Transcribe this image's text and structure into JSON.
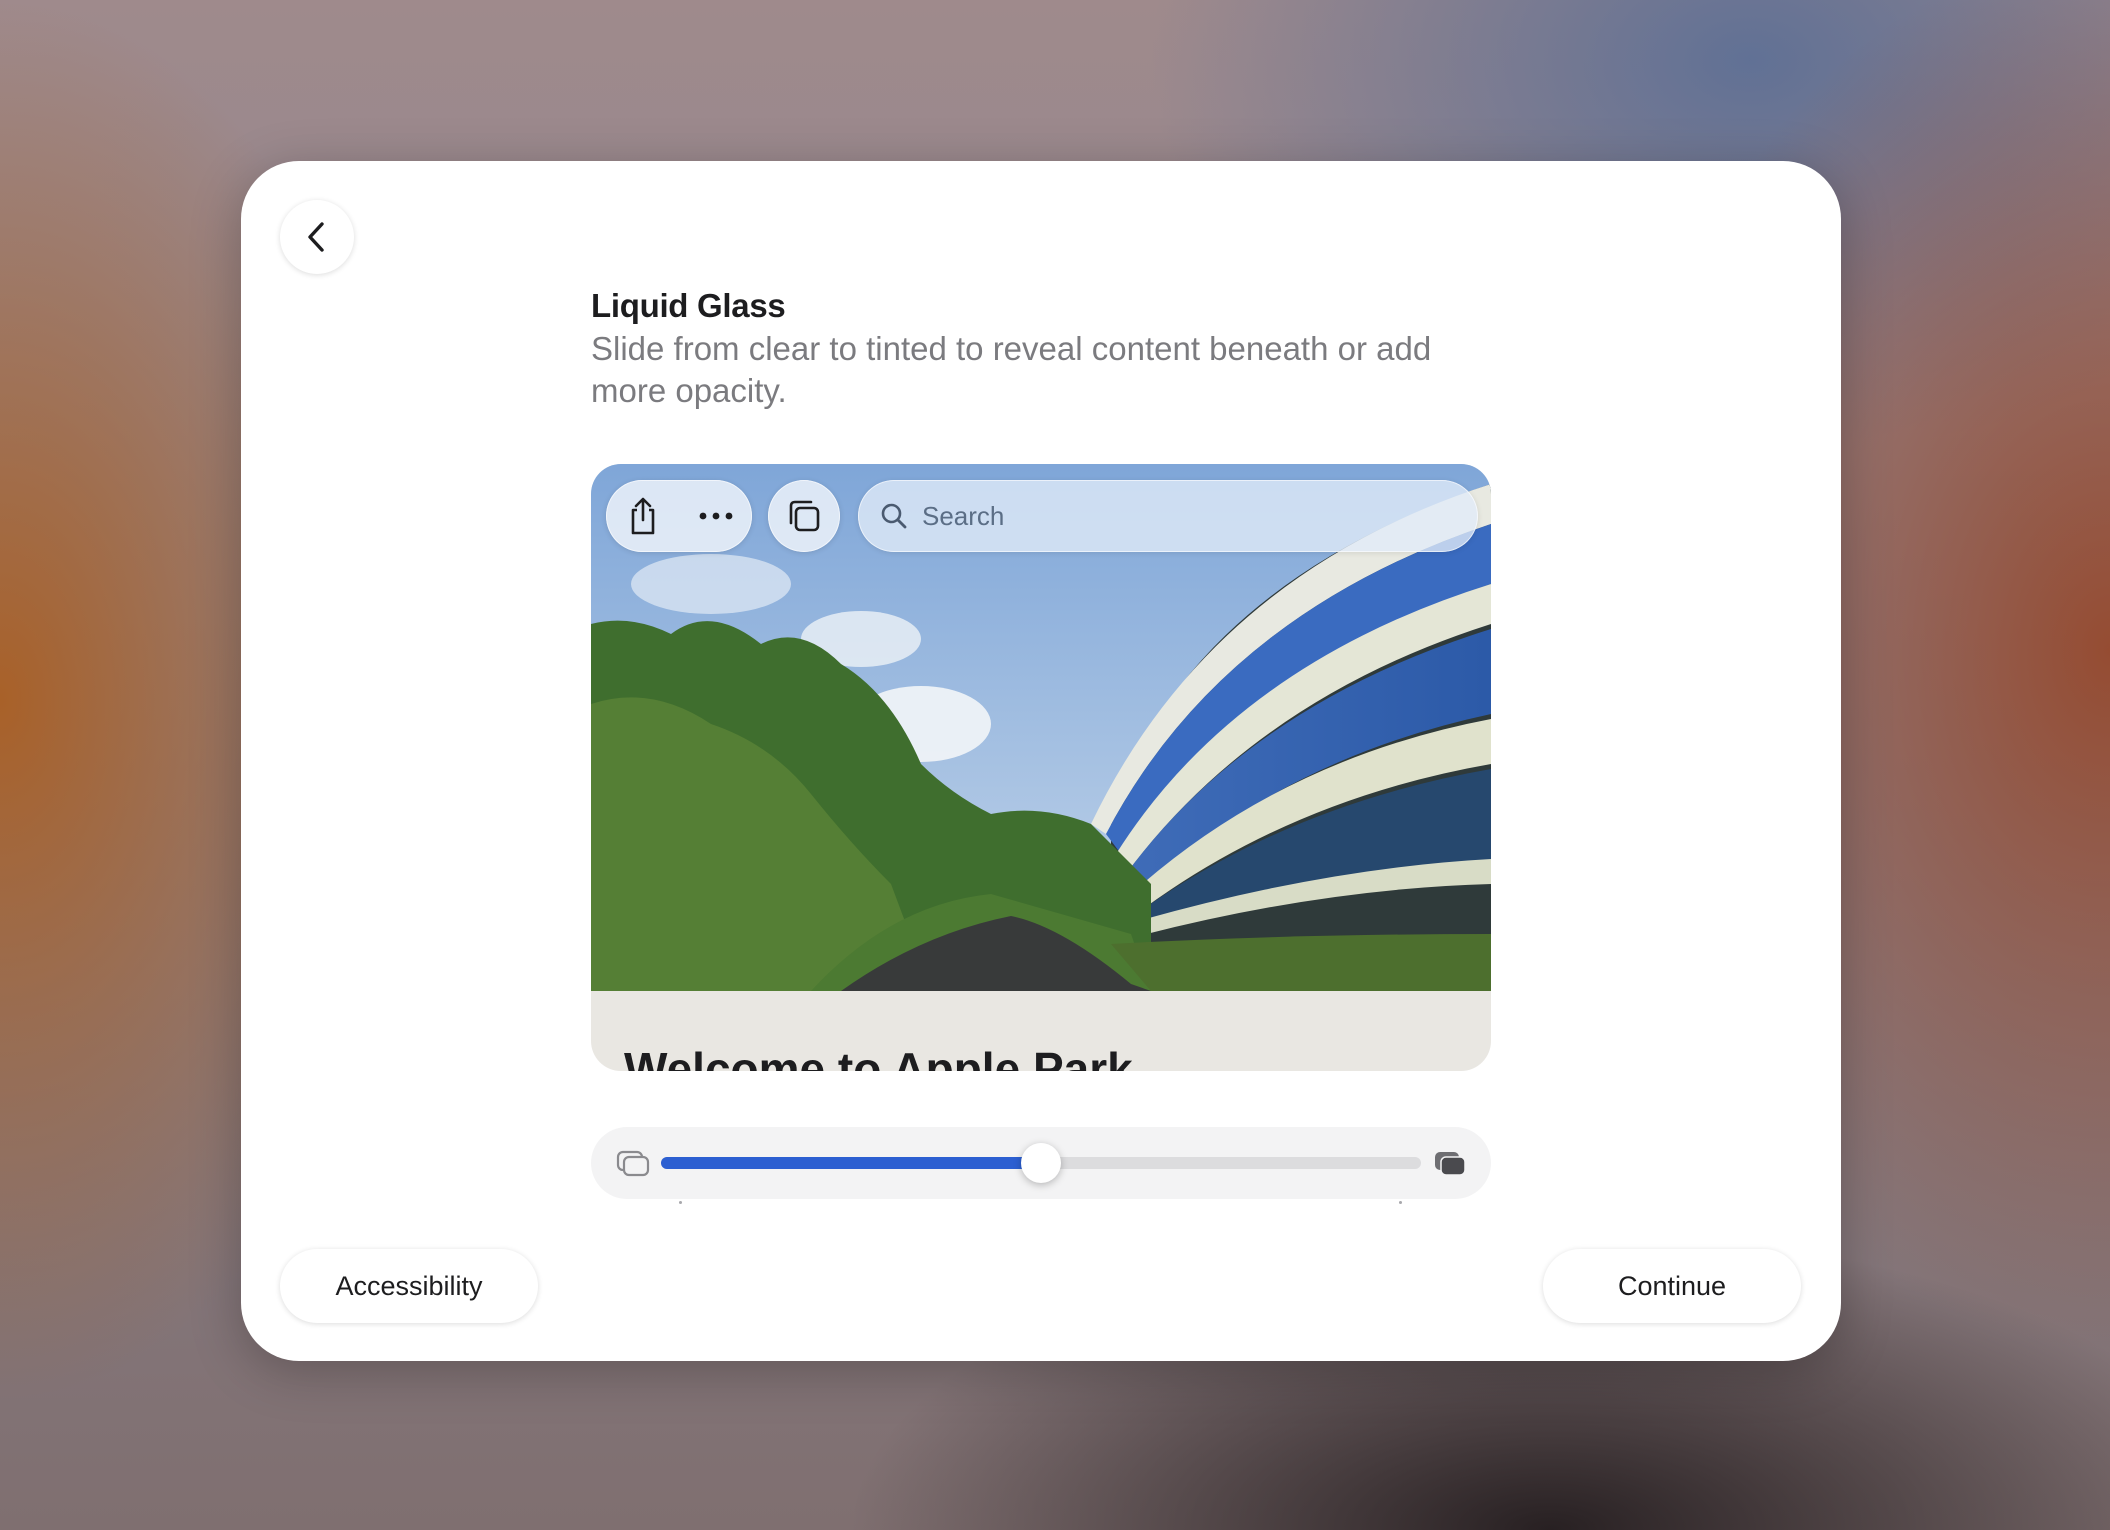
{
  "header": {
    "title": "Liquid Glass",
    "subtitle": "Slide from clear to tinted to reveal content beneath or add more opacity."
  },
  "preview": {
    "search_placeholder": "Search",
    "article_title": "Welcome to Apple Park",
    "icons": [
      "share-icon",
      "more-icon",
      "tabs-icon",
      "search-icon"
    ]
  },
  "slider": {
    "min_label_icon": "clear-glass-icon",
    "max_label_icon": "tinted-glass-icon",
    "value_fraction": 0.5,
    "accent_color": "#2c5fd1"
  },
  "footer": {
    "accessibility_label": "Accessibility",
    "continue_label": "Continue"
  }
}
